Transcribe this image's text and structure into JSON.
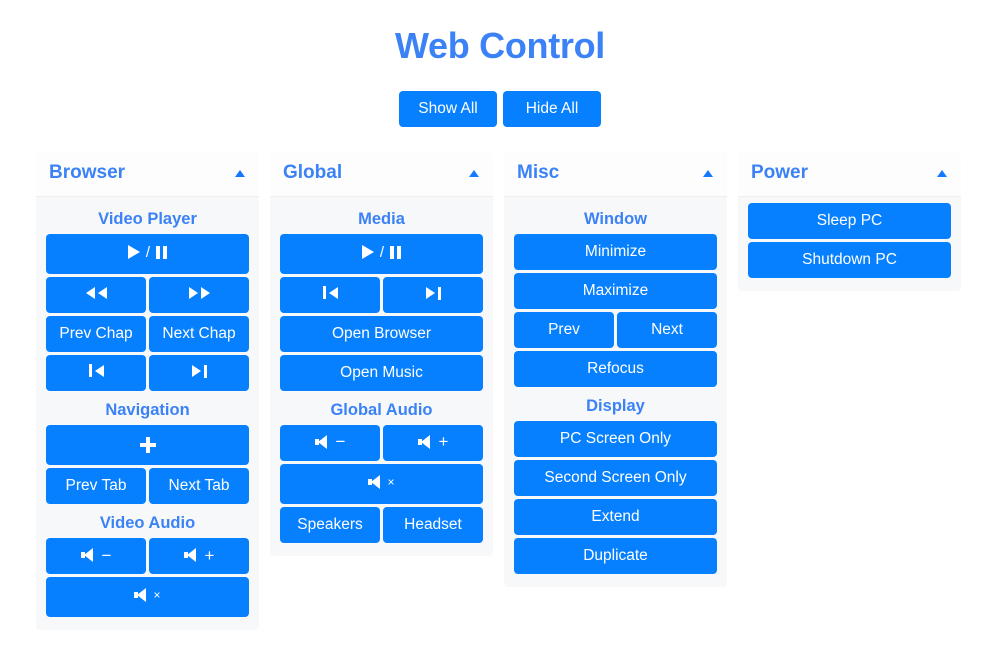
{
  "header": {
    "title": "Web Control",
    "show_all_label": "Show All",
    "hide_all_label": "Hide All"
  },
  "colors": {
    "button_blue": "#0680ff",
    "title_blue": "#3b82f6",
    "panel_bg": "#f7f8f9",
    "panel_header_bg": "#fdfdfd",
    "page_bg": "#ffffff",
    "button_text": "#ffffff"
  },
  "panels": [
    {
      "id": "browser",
      "title": "Browser",
      "collapse_icon": "caret-up-icon",
      "sections": [
        {
          "title": "Video Player",
          "rows": [
            {
              "buttons": [
                {
                  "icon": "play-pause-icon",
                  "label": ""
                }
              ]
            },
            {
              "buttons": [
                {
                  "icon": "rewind-icon",
                  "label": ""
                },
                {
                  "icon": "fast-forward-icon",
                  "label": ""
                }
              ]
            },
            {
              "buttons": [
                {
                  "icon": "",
                  "label": "Prev Chap"
                },
                {
                  "icon": "",
                  "label": "Next Chap"
                }
              ]
            },
            {
              "buttons": [
                {
                  "icon": "skip-previous-icon",
                  "label": ""
                },
                {
                  "icon": "skip-next-icon",
                  "label": ""
                }
              ]
            }
          ]
        },
        {
          "title": "Navigation",
          "rows": [
            {
              "buttons": [
                {
                  "icon": "fullscreen-icon",
                  "label": ""
                }
              ]
            },
            {
              "buttons": [
                {
                  "icon": "",
                  "label": "Prev Tab"
                },
                {
                  "icon": "",
                  "label": "Next Tab"
                }
              ]
            }
          ]
        },
        {
          "title": "Video Audio",
          "rows": [
            {
              "buttons": [
                {
                  "icon": "volume-down-icon",
                  "label": ""
                },
                {
                  "icon": "volume-up-icon",
                  "label": ""
                }
              ]
            },
            {
              "buttons": [
                {
                  "icon": "volume-mute-icon",
                  "label": ""
                }
              ]
            }
          ]
        }
      ]
    },
    {
      "id": "global",
      "title": "Global",
      "collapse_icon": "caret-up-icon",
      "sections": [
        {
          "title": "Media",
          "rows": [
            {
              "buttons": [
                {
                  "icon": "play-pause-icon",
                  "label": ""
                }
              ]
            },
            {
              "buttons": [
                {
                  "icon": "skip-previous-icon",
                  "label": ""
                },
                {
                  "icon": "skip-next-icon",
                  "label": ""
                }
              ]
            },
            {
              "buttons": [
                {
                  "icon": "",
                  "label": "Open Browser"
                }
              ]
            },
            {
              "buttons": [
                {
                  "icon": "",
                  "label": "Open Music"
                }
              ]
            }
          ]
        },
        {
          "title": "Global Audio",
          "rows": [
            {
              "buttons": [
                {
                  "icon": "volume-down-icon",
                  "label": ""
                },
                {
                  "icon": "volume-up-icon",
                  "label": ""
                }
              ]
            },
            {
              "buttons": [
                {
                  "icon": "volume-mute-icon",
                  "label": ""
                }
              ]
            },
            {
              "buttons": [
                {
                  "icon": "",
                  "label": "Speakers"
                },
                {
                  "icon": "",
                  "label": "Headset"
                }
              ]
            }
          ]
        }
      ]
    },
    {
      "id": "misc",
      "title": "Misc",
      "collapse_icon": "caret-up-icon",
      "sections": [
        {
          "title": "Window",
          "rows": [
            {
              "buttons": [
                {
                  "icon": "",
                  "label": "Minimize"
                }
              ]
            },
            {
              "buttons": [
                {
                  "icon": "",
                  "label": "Maximize"
                }
              ]
            },
            {
              "buttons": [
                {
                  "icon": "",
                  "label": "Prev"
                },
                {
                  "icon": "",
                  "label": "Next"
                }
              ]
            },
            {
              "buttons": [
                {
                  "icon": "",
                  "label": "Refocus"
                }
              ]
            }
          ]
        },
        {
          "title": "Display",
          "rows": [
            {
              "buttons": [
                {
                  "icon": "",
                  "label": "PC Screen Only"
                }
              ]
            },
            {
              "buttons": [
                {
                  "icon": "",
                  "label": "Second Screen Only"
                }
              ]
            },
            {
              "buttons": [
                {
                  "icon": "",
                  "label": "Extend"
                }
              ]
            },
            {
              "buttons": [
                {
                  "icon": "",
                  "label": "Duplicate"
                }
              ]
            }
          ]
        }
      ]
    },
    {
      "id": "power",
      "title": "Power",
      "collapse_icon": "caret-up-icon",
      "sections": [
        {
          "title": "",
          "rows": [
            {
              "buttons": [
                {
                  "icon": "",
                  "label": "Sleep PC"
                }
              ]
            },
            {
              "buttons": [
                {
                  "icon": "",
                  "label": "Shutdown PC"
                }
              ]
            }
          ]
        }
      ]
    }
  ]
}
